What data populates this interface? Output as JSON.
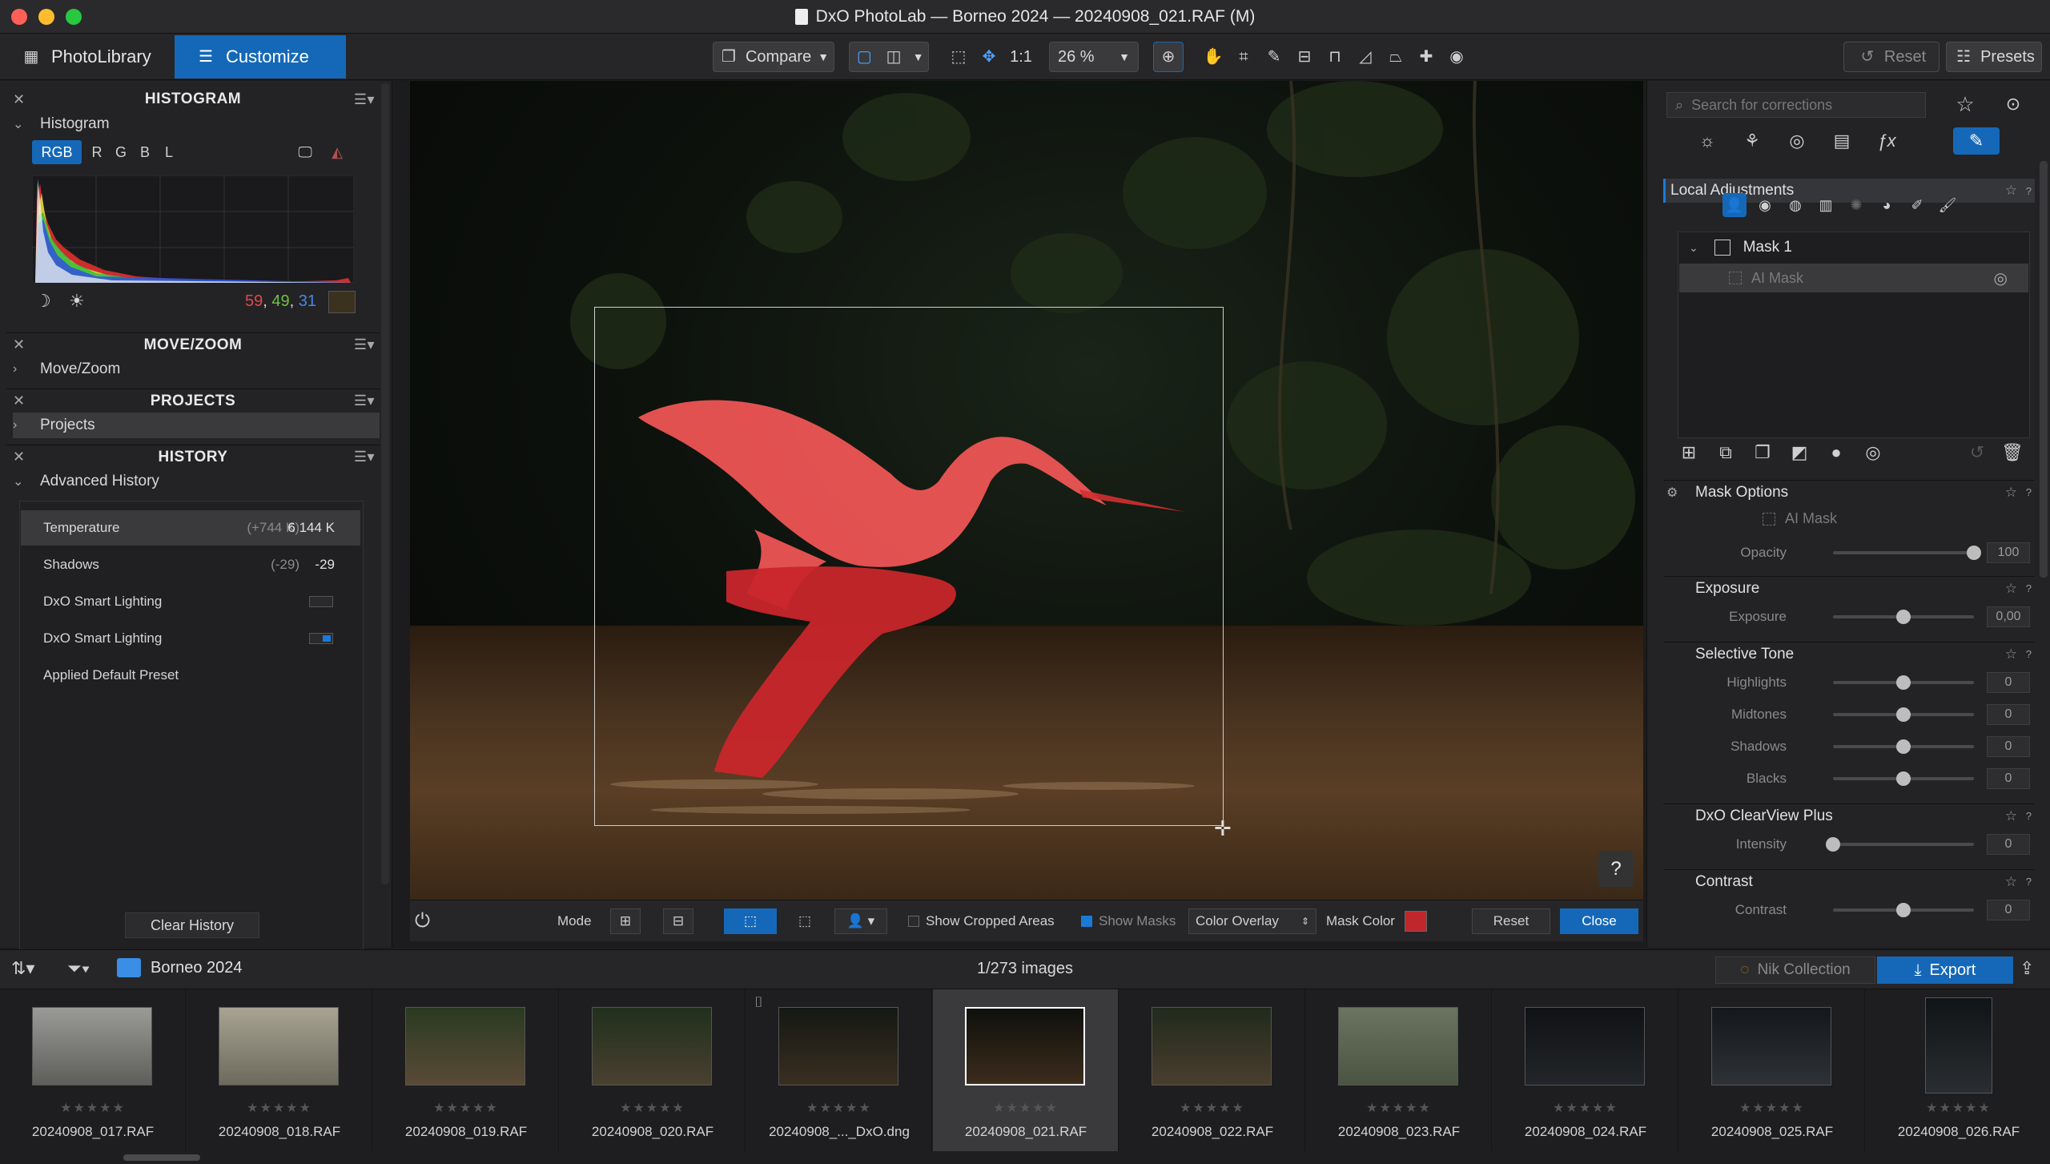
{
  "window": {
    "title": "DxO PhotoLab — Borneo 2024 — 20240908_021.RAF (M)",
    "light_colors": [
      "#ff5f57",
      "#febc2e",
      "#28c840"
    ]
  },
  "toolbar": {
    "tab_photolibrary": "PhotoLibrary",
    "tab_customize": "Customize",
    "compare_label": "Compare",
    "one_to_one": "1:1",
    "zoom": "26 %",
    "reset_label": "Reset",
    "presets_label": "Presets"
  },
  "left_panel": {
    "histogram": {
      "header": "HISTOGRAM",
      "subheader": "Histogram",
      "channels": [
        "RGB",
        "R",
        "G",
        "B",
        "L"
      ],
      "rgb_readout": {
        "r": "59",
        "g": "49",
        "b": "31",
        "sep": ","
      }
    },
    "movezoom": {
      "header": "MOVE/ZOOM",
      "subheader": "Move/Zoom"
    },
    "projects": {
      "header": "PROJECTS",
      "subheader": "Projects"
    },
    "history": {
      "header": "HISTORY",
      "subheader": "Advanced History",
      "items": [
        {
          "label": "Temperature",
          "old": "(+744 K)",
          "new": "6 144 K"
        },
        {
          "label": "Shadows",
          "old": "(-29)",
          "new": "-29"
        },
        {
          "label": "DxO Smart Lighting",
          "old": "",
          "new": ""
        },
        {
          "label": "DxO Smart Lighting",
          "old": "",
          "new": ""
        },
        {
          "label": "Applied Default Preset",
          "old": "",
          "new": ""
        }
      ],
      "clear_button": "Clear History"
    }
  },
  "viewer": {
    "help_button": "?",
    "bottom_bar": {
      "mode_label": "Mode",
      "show_cropped": "Show Cropped Areas",
      "show_masks": "Show Masks",
      "overlay_select": "Color Overlay",
      "mask_color_label": "Mask Color",
      "mask_color": "#c0272d",
      "reset_button": "Reset",
      "close_button": "Close"
    }
  },
  "right_panel": {
    "search_placeholder": "Search for corrections",
    "local_adjustments": "Local Adjustments",
    "mask_name": "Mask 1",
    "ai_mask_item": "AI Mask",
    "mask_options": {
      "title": "Mask Options",
      "type": "AI Mask",
      "opacity_label": "Opacity",
      "opacity_value": "100",
      "opacity_frac": 1.0
    },
    "exposure": {
      "title": "Exposure",
      "label": "Exposure",
      "value": "0,00",
      "frac": 0.5
    },
    "selective_tone": {
      "title": "Selective Tone",
      "rows": [
        {
          "label": "Highlights",
          "value": "0",
          "frac": 0.5
        },
        {
          "label": "Midtones",
          "value": "0",
          "frac": 0.5
        },
        {
          "label": "Shadows",
          "value": "0",
          "frac": 0.5
        },
        {
          "label": "Blacks",
          "value": "0",
          "frac": 0.5
        }
      ]
    },
    "clearview": {
      "title": "DxO ClearView Plus",
      "label": "Intensity",
      "value": "0",
      "frac": 0.0
    },
    "contrast": {
      "title": "Contrast",
      "label": "Contrast",
      "value": "0",
      "frac": 0.5
    }
  },
  "filmstrip": {
    "folder": "Borneo 2024",
    "count": "1/273 images",
    "nik_label": "Nik Collection",
    "export_label": "Export",
    "stars": "★★★★★",
    "thumbs": [
      {
        "name": "20240908_017.RAF",
        "tone": "#7c7c78"
      },
      {
        "name": "20240908_018.RAF",
        "tone": "#8a8676"
      },
      {
        "name": "20240908_019.RAF",
        "tone": "#3a3f30"
      },
      {
        "name": "20240908_020.RAF",
        "tone": "#263322"
      },
      {
        "name": "20240908_..._DxO.dng",
        "tone": "#1e211c"
      },
      {
        "name": "20240908_021.RAF",
        "tone": "#151511"
      },
      {
        "name": "20240908_022.RAF",
        "tone": "#2e3328"
      },
      {
        "name": "20240908_023.RAF",
        "tone": "#5a6450"
      },
      {
        "name": "20240908_024.RAF",
        "tone": "#15181a"
      },
      {
        "name": "20240908_025.RAF",
        "tone": "#1c2024"
      },
      {
        "name": "20240908_026.RAF",
        "tone": "#161a1c"
      }
    ]
  }
}
